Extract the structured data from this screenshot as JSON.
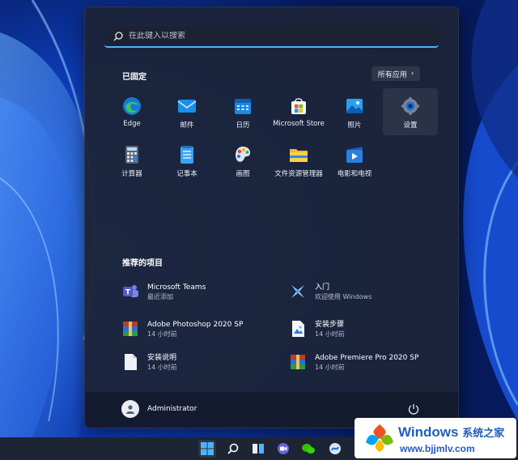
{
  "search": {
    "placeholder": "在此键入以搜索"
  },
  "pinned": {
    "title": "已固定",
    "all_apps_label": "所有应用",
    "apps": [
      {
        "label": "Edge",
        "icon": "edge-icon"
      },
      {
        "label": "邮件",
        "icon": "mail-icon"
      },
      {
        "label": "日历",
        "icon": "calendar-icon"
      },
      {
        "label": "Microsoft Store",
        "icon": "store-icon"
      },
      {
        "label": "照片",
        "icon": "photos-icon"
      },
      {
        "label": "设置",
        "icon": "gear-icon"
      },
      {
        "label": "计算器",
        "icon": "calculator-icon"
      },
      {
        "label": "记事本",
        "icon": "notepad-icon"
      },
      {
        "label": "画图",
        "icon": "paint-icon"
      },
      {
        "label": "文件资源管理器",
        "icon": "folder-icon"
      },
      {
        "label": "电影和电视",
        "icon": "movies-icon"
      }
    ]
  },
  "recommended": {
    "title": "推荐的项目",
    "items": [
      {
        "name": "Microsoft Teams",
        "time": "最近添加",
        "icon": "teams-icon"
      },
      {
        "name": "入门",
        "time": "欢迎使用 Windows",
        "icon": "tips-icon"
      },
      {
        "name": "Adobe Photoshop 2020 SP",
        "time": "14 小时前",
        "icon": "archive-icon"
      },
      {
        "name": "安装步骤",
        "time": "14 小时前",
        "icon": "image-file-icon"
      },
      {
        "name": "安装说明",
        "time": "14 小时前",
        "icon": "document-icon"
      },
      {
        "name": "Adobe Premiere Pro 2020 SP",
        "time": "14 小时前",
        "icon": "archive-icon"
      }
    ]
  },
  "user": {
    "name": "Administrator"
  },
  "watermark": {
    "title": "Windows",
    "subtitle": "系统之家",
    "url": "www.bjjmlv.com"
  },
  "colors": {
    "accent": "#4fb3ff",
    "menu_bg": "#1c243a",
    "taskbar": "#1d2434"
  }
}
